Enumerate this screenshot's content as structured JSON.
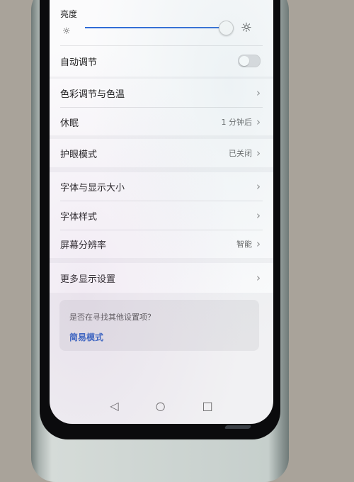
{
  "brightness": {
    "label": "亮度",
    "level": 0.97,
    "small_icon": "☼",
    "large_icon": "☼"
  },
  "settings": [
    {
      "label": "自动调节",
      "control": "toggle",
      "state": "off"
    },
    {
      "label": "色彩调节与色温",
      "value": "",
      "chevron": "›"
    },
    {
      "label": "休眠",
      "value": "1 分钟后",
      "chevron": "›"
    },
    {
      "label": "护眼模式",
      "value": "已关闭",
      "chevron": "›"
    },
    {
      "label": "字体与显示大小",
      "value": "",
      "chevron": "›"
    },
    {
      "label": "字体样式",
      "value": "",
      "chevron": "›"
    },
    {
      "label": "屏幕分辨率",
      "value": "智能",
      "chevron": "›"
    },
    {
      "label": "更多显示设置",
      "value": "",
      "chevron": "›"
    }
  ],
  "hint": {
    "question": "是否在寻找其他设置项？",
    "link": "简易模式"
  },
  "nav": {
    "back": "◁",
    "home": "○",
    "recents": "□"
  },
  "colors": {
    "accent": "#2f6bd6",
    "link": "#2d5fc0"
  }
}
